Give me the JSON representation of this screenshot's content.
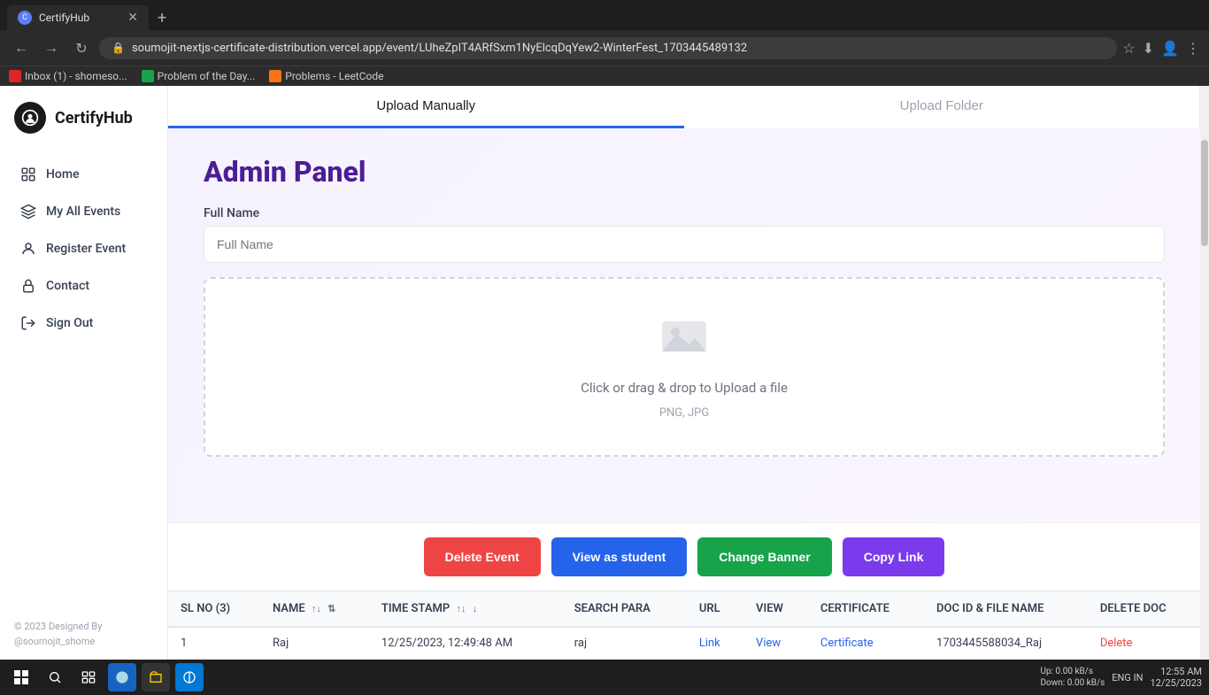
{
  "browser": {
    "tab_title": "CertifyHub",
    "url": "soumojit-nextjs-certificate-distribution.vercel.app/event/LUheZpIT4ARfSxm1NyElcqDqYew2-WinterFest_1703445489132",
    "bookmarks": [
      {
        "label": "Inbox (1) - shomeso...",
        "icon_color": "#dc2626"
      },
      {
        "label": "Problem of the Day...",
        "icon_color": "#16a34a"
      },
      {
        "label": "Problems - LeetCode",
        "icon_color": "#f97316"
      }
    ]
  },
  "app": {
    "name": "CertifyHub"
  },
  "sidebar": {
    "items": [
      {
        "id": "home",
        "label": "Home"
      },
      {
        "id": "my-all-events",
        "label": "My All Events"
      },
      {
        "id": "register-event",
        "label": "Register Event"
      },
      {
        "id": "contact",
        "label": "Contact"
      },
      {
        "id": "sign-out",
        "label": "Sign Out"
      }
    ],
    "footer": "© 2023 Designed By @soumojit_shome"
  },
  "tabs": [
    {
      "id": "upload-manually",
      "label": "Upload Manually",
      "active": true
    },
    {
      "id": "upload-folder",
      "label": "Upload Folder",
      "active": false
    }
  ],
  "admin_panel": {
    "title": "Admin Panel",
    "form": {
      "full_name_label": "Full Name",
      "full_name_placeholder": "Full Name"
    },
    "upload": {
      "text": "Click or drag & drop to Upload a file",
      "subtext": "PNG, JPG"
    }
  },
  "action_buttons": [
    {
      "id": "delete-event",
      "label": "Delete Event",
      "color": "#ef4444"
    },
    {
      "id": "view-as-student",
      "label": "View as student",
      "color": "#2563eb"
    },
    {
      "id": "change-banner",
      "label": "Change Banner",
      "color": "#16a34a"
    },
    {
      "id": "copy-link",
      "label": "Copy Link",
      "color": "#7c3aed"
    }
  ],
  "table": {
    "columns": [
      {
        "id": "sl_no",
        "label": "SL NO (3)"
      },
      {
        "id": "name",
        "label": "NAME"
      },
      {
        "id": "timestamp",
        "label": "TIME STAMP"
      },
      {
        "id": "search_para",
        "label": "SEARCH PARA"
      },
      {
        "id": "url",
        "label": "URL"
      },
      {
        "id": "view",
        "label": "VIEW"
      },
      {
        "id": "certificate",
        "label": "CERTIFICATE"
      },
      {
        "id": "doc_id",
        "label": "DOC ID & FILE NAME"
      },
      {
        "id": "delete_doc",
        "label": "DELETE DOC"
      }
    ],
    "rows": [
      {
        "sl_no": "1",
        "name": "Raj",
        "timestamp": "12/25/2023, 12:49:48 AM",
        "search_para": "raj",
        "url": "Link",
        "view": "View",
        "certificate": "Certificate",
        "doc_id": "1703445588034_Raj",
        "delete_doc": "Delete"
      }
    ]
  },
  "taskbar": {
    "network_up": "0.00 kB/s",
    "network_down": "0.00 kB/s",
    "time": "12:55 AM",
    "date": "12/25/2023",
    "language": "ENG IN"
  }
}
